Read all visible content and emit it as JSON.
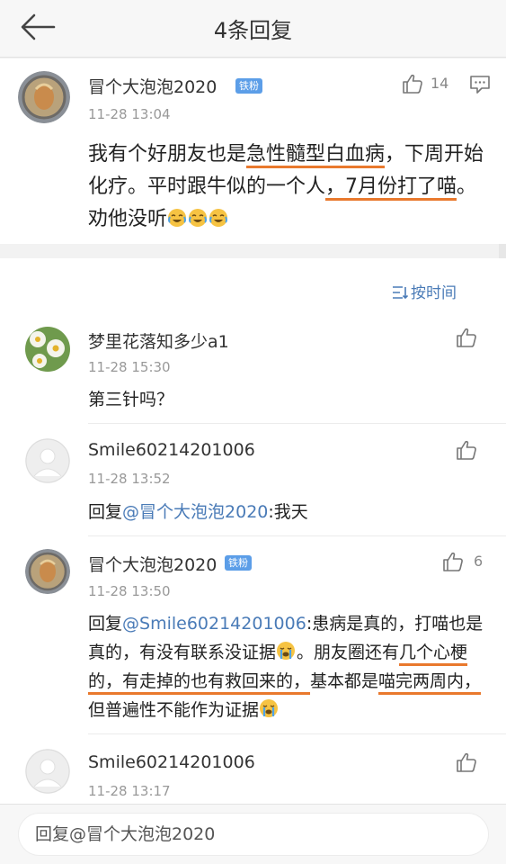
{
  "header": {
    "title": "4条回复"
  },
  "main_comment": {
    "username": "冒个大泡泡2020",
    "badge": "铁粉",
    "timestamp": "11-28 13:04",
    "likes": "14",
    "text": {
      "p1": "我有个好朋友也是",
      "u1": "急性髓型白血病",
      "p2": "，下周开始化疗。平时跟牛似的一个人",
      "u2": "，7月份打了喵",
      "p3": "。劝他没听"
    },
    "emoji": [
      "crying-laughing-emoji",
      "crying-laughing-emoji",
      "crying-laughing-emoji"
    ]
  },
  "sort": {
    "label": "按时间"
  },
  "replies": [
    {
      "username": "梦里花落知多少a1",
      "timestamp": "11-28 15:30",
      "text": "第三针吗？",
      "likes": ""
    },
    {
      "username": "Smile60214201006",
      "timestamp": "11-28 13:52",
      "reply_prefix": "回复",
      "mention": "@冒个大泡泡2020",
      "text": ":我天",
      "likes": ""
    },
    {
      "username": "冒个大泡泡2020",
      "badge": "铁粉",
      "timestamp": "11-28 13:50",
      "reply_prefix": "回复",
      "mention": "@Smile60214201006",
      "text": {
        "p1": ":患病是真的，打喵也是真的，有没有联系没证据",
        "p2": "。朋友圈还有",
        "u1": "几个心梗的，有走掉的也有救回来的，",
        "p3": "基本都是",
        "u2": "喵完两周内，",
        "p4": "但普遍性不能作为证据"
      },
      "likes": "6"
    },
    {
      "username": "Smile60214201006",
      "timestamp": "11-28 13:17",
      "likes": ""
    }
  ],
  "reply_input": {
    "placeholder": "回复@冒个大泡泡2020"
  },
  "colors": {
    "accent": "#4a7bb7",
    "underline": "#e9792d",
    "badge": "#5c9ee8"
  }
}
